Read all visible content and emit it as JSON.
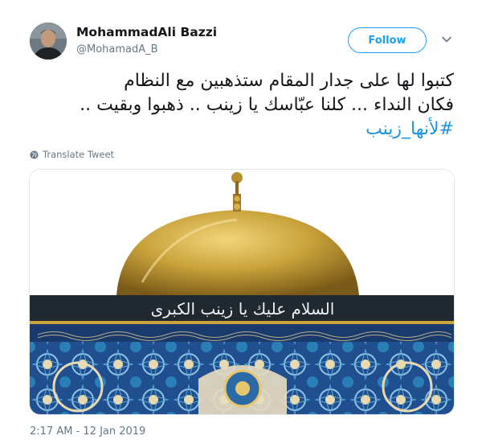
{
  "author": {
    "name": "MohammadAli Bazzi",
    "handle": "@MohamadA_B"
  },
  "follow_button": {
    "label": "Follow"
  },
  "tweet": {
    "lines": [
      "كتبوا لها على جدار المقام ستذهبين مع النظام",
      "فكان النداء ... كلنا عبّاسك يا زينب .. ذهبوا وبقيت ..",
      "#لأنها_زينب"
    ]
  },
  "translate": {
    "label": "Translate Tweet"
  },
  "media": {
    "inscription": "السلام عليك يا زينب الكبرى"
  },
  "timestamp": "2:17 AM - 12 Jan 2019",
  "colors": {
    "accent": "#1da1f2",
    "hashtag": "#1b95e0",
    "muted": "#657786",
    "dome_gold": "#c9a23a",
    "tile_blue": "#1f4f8e"
  }
}
